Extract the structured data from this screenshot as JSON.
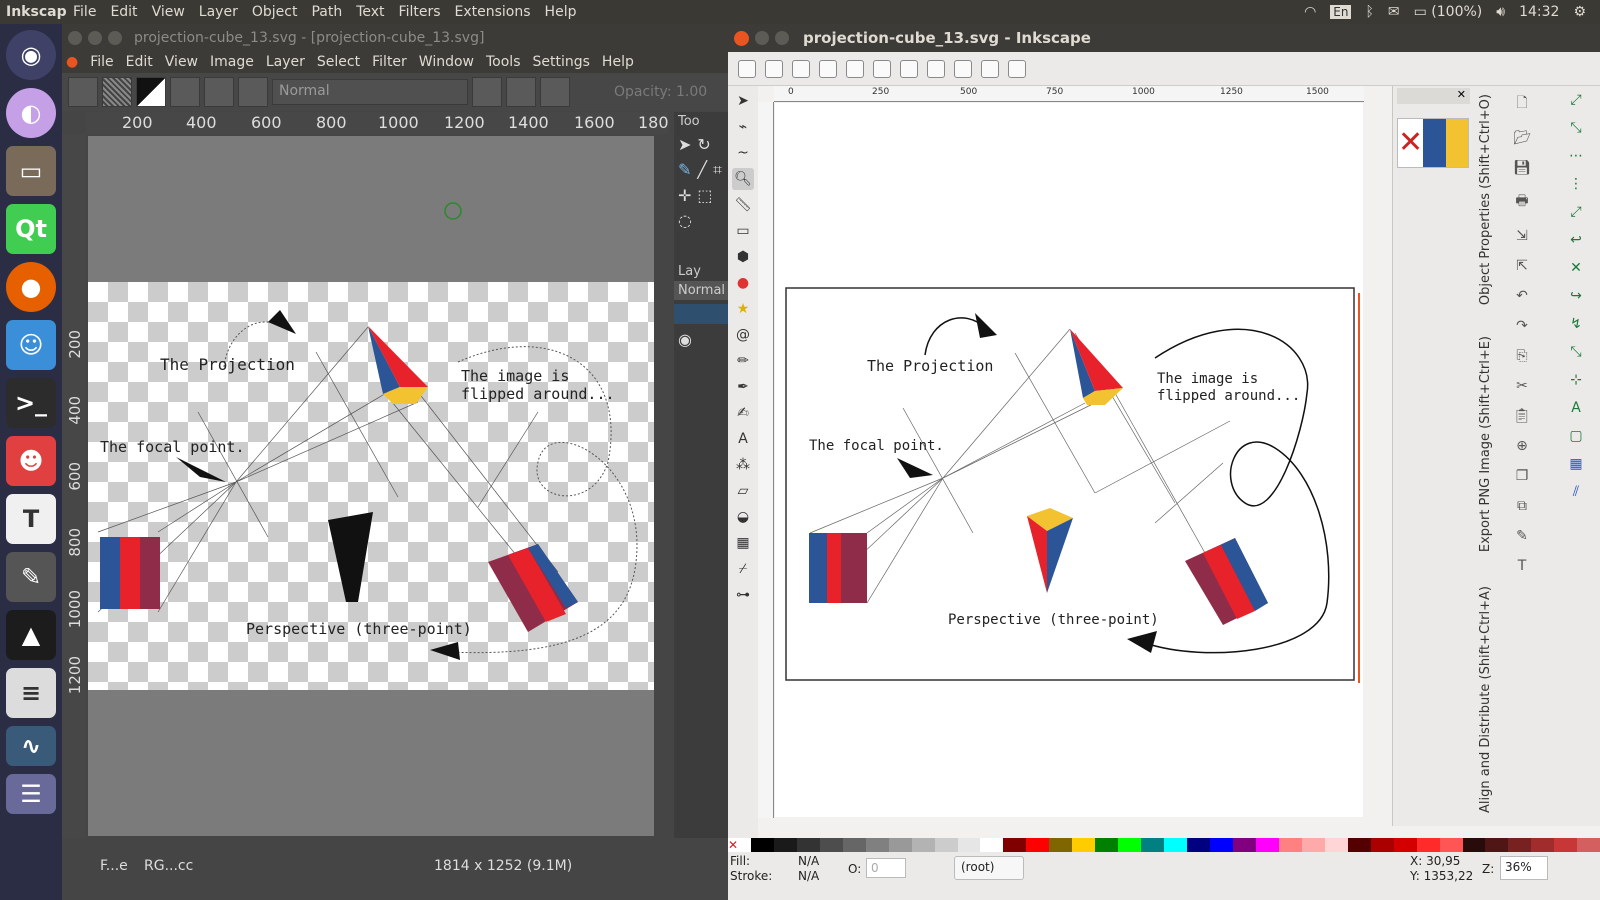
{
  "topbar": {
    "app": "Inkscape",
    "menus": [
      "File",
      "Edit",
      "View",
      "Layer",
      "Object",
      "Path",
      "Text",
      "Filters",
      "Extensions",
      "Help"
    ],
    "lang": "En",
    "battery": "(100%)",
    "time": "14:32"
  },
  "launcher": {
    "icons": [
      "ubuntu-icon",
      "browser-icon",
      "files-icon",
      "qt-icon",
      "firefox-icon",
      "chat-icon",
      "terminal-icon",
      "ghost-icon",
      "text-editor-icon",
      "feather-icon",
      "inkscape-icon",
      "document-icon",
      "monitor-icon",
      "stack-icon"
    ],
    "qt_label": "Qt",
    "text_label": "T"
  },
  "gimp": {
    "title": "projection-cube_13.svg - [projection-cube_13.svg]",
    "menus": [
      "File",
      "Edit",
      "View",
      "Image",
      "Layer",
      "Select",
      "Filter",
      "Window",
      "Tools",
      "Settings",
      "Help"
    ],
    "mode": "Normal",
    "opacity": "Opacity: 1.00",
    "ruler": [
      "200",
      "400",
      "600",
      "800",
      "1000",
      "1200",
      "1400",
      "1600",
      "180"
    ],
    "vruler": [
      "200",
      "400",
      "600",
      "800",
      "1000",
      "1200"
    ],
    "dock_tools_label": "Too",
    "dock_layers_label": "Lay",
    "dock_mode": "Normal",
    "canvas_texts": {
      "projection": "The Projection",
      "flipped1": "The image is",
      "flipped2": "flipped around...",
      "focal": "The focal point.",
      "perspective": "Perspective (three-point)"
    },
    "status": {
      "left1": "F...e",
      "left2": "RG...cc",
      "size": "1814 x 1252 (9.1M)"
    }
  },
  "inkscape": {
    "title": "projection-cube_13.svg - Inkscape",
    "ruler": [
      "0",
      "250",
      "500",
      "750",
      "1000",
      "1250",
      "1500"
    ],
    "canvas_texts": {
      "projection": "The Projection",
      "flipped1": "The image is",
      "flipped2": "flipped around...",
      "focal": "The focal point.",
      "perspective": "Perspective (three-point)"
    },
    "tabs": [
      "Object Properties (Shift+Ctrl+O)",
      "Export PNG Image (Shift+Ctrl+E)",
      "Align and Distribute (Shift+Ctrl+A)"
    ],
    "status": {
      "fill_label": "Fill:",
      "fill_val": "N/A",
      "stroke_label": "Stroke:",
      "stroke_val": "N/A",
      "o_label": "O:",
      "o_val": "0",
      "layer": "(root)",
      "x": "X:   30,95",
      "y": "Y: 1353,22",
      "z_label": "Z:",
      "zoom": "36%"
    },
    "colors": {
      "red": "#e8222b",
      "blue": "#2b5596",
      "maroon": "#8f2c4a",
      "yellow": "#f2c230"
    }
  }
}
